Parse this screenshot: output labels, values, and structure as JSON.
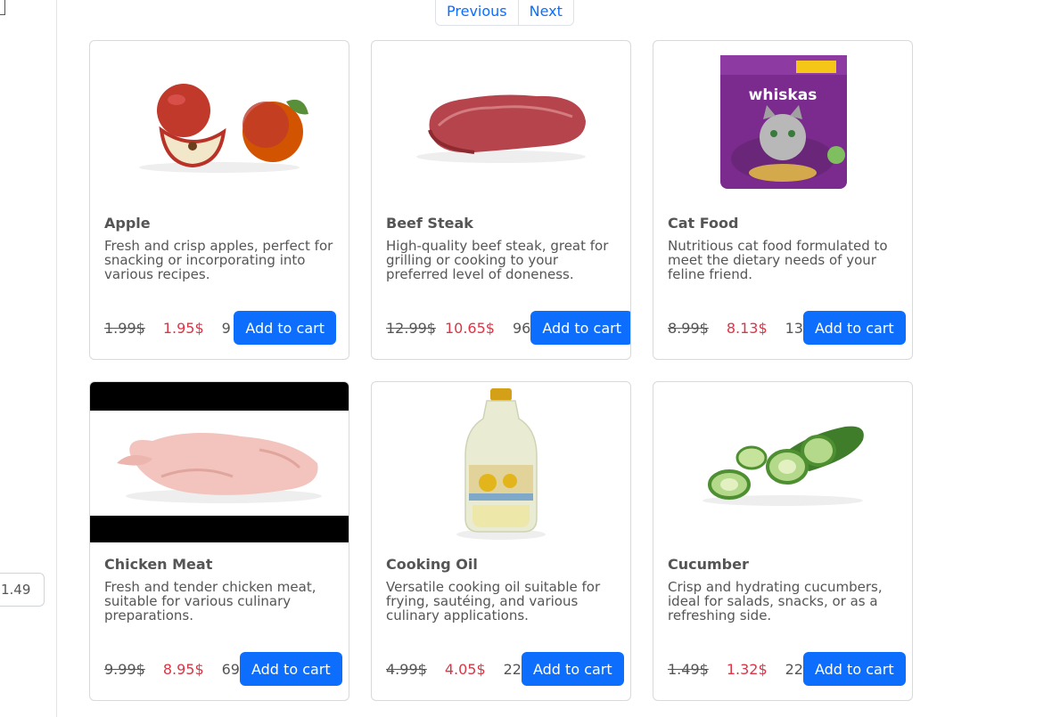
{
  "sidebar": {
    "number_input_value": "1.49"
  },
  "pagination": {
    "previous_label": "Previous",
    "next_label": "Next"
  },
  "products": [
    {
      "name": "Apple",
      "description": "Fresh and crisp apples, perfect for snacking or incorporating into various recipes.",
      "old_price": "1.99$",
      "price": "1.95$",
      "stock": "9",
      "button": "Add to cart",
      "image": "apple-image"
    },
    {
      "name": "Beef Steak",
      "description": "High-quality beef steak, great for grilling or cooking to your preferred level of doneness.",
      "old_price": "12.99$",
      "price": "10.65$",
      "stock": "96",
      "button": "Add to cart",
      "image": "steak-image"
    },
    {
      "name": "Cat Food",
      "description": "Nutritious cat food formulated to meet the dietary needs of your feline friend.",
      "old_price": "8.99$",
      "price": "8.13$",
      "stock": "13",
      "button": "Add to cart",
      "image": "cat-food-image",
      "image_text": "whiskas"
    },
    {
      "name": "Chicken Meat",
      "description": "Fresh and tender chicken meat, suitable for various culinary preparations.",
      "old_price": "9.99$",
      "price": "8.95$",
      "stock": "69",
      "button": "Add to cart",
      "image": "chicken-image"
    },
    {
      "name": "Cooking Oil",
      "description": "Versatile cooking oil suitable for frying, sautéing, and various culinary applications.",
      "old_price": "4.99$",
      "price": "4.05$",
      "stock": "22",
      "button": "Add to cart",
      "image": "cooking-oil-image"
    },
    {
      "name": "Cucumber",
      "description": "Crisp and hydrating cucumbers, ideal for salads, snacks, or as a refreshing side.",
      "old_price": "1.49$",
      "price": "1.32$",
      "stock": "22",
      "button": "Add to cart",
      "image": "cucumber-image"
    }
  ],
  "colors": {
    "primary": "#0d6efd",
    "discount": "#dc3545",
    "border": "#d9d9d9"
  }
}
